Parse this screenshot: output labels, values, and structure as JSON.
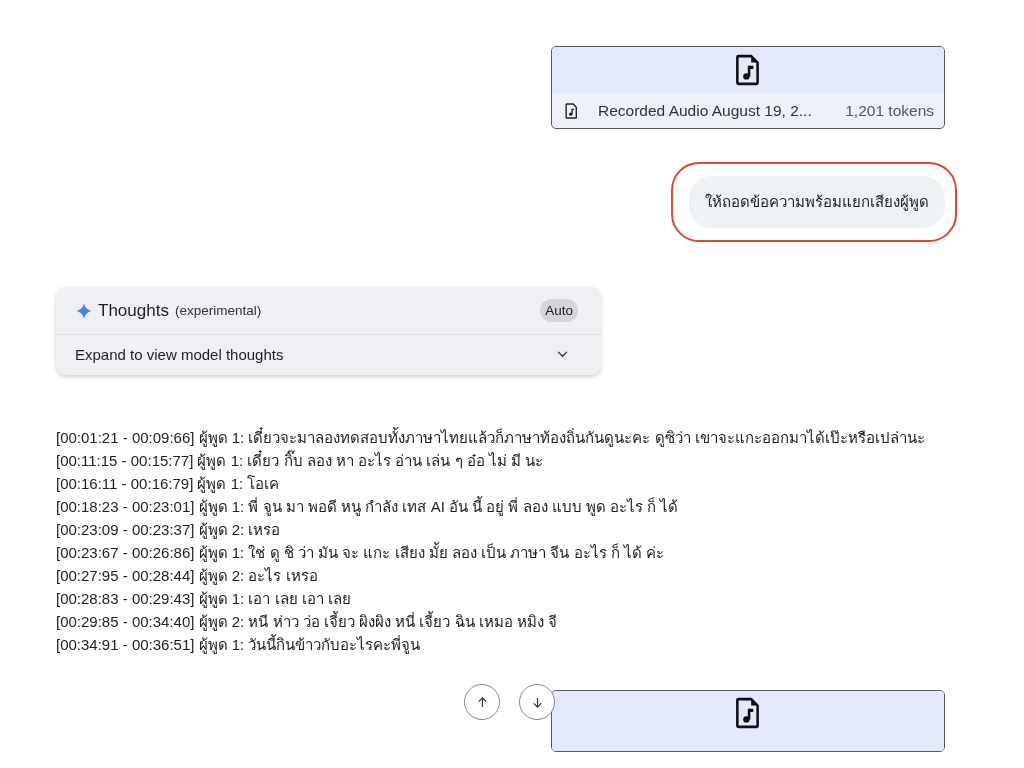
{
  "attachment": {
    "kind": "audio",
    "name": "Recorded Audio August 19, 2...",
    "tokens": "1,201 tokens"
  },
  "prompt": {
    "text": "ให้ถอดข้อความพร้อมแยกเสียงผู้พูด",
    "highlighted": true
  },
  "thoughts": {
    "title": "Thoughts",
    "subtitle": "(experimental)",
    "mode": "Auto",
    "expand_label": "Expand to view model thoughts",
    "expanded": false
  },
  "transcript": [
    "[00:01:21 - 00:09:66] ผู้พูด 1: เดี๋ยวจะมาลองทดสอบทั้งภาษาไทยแล้วก็ภาษาท้องถิ่นกันดูนะคะ ดูซิว่า เขาจะแกะออกมาได้เป๊ะหรือเปล่านะ",
    "[00:11:15 - 00:15:77] ผู้พูด 1: เดี๋ยว กิ๊บ ลอง หา อะไร อ่าน เล่น ๆ อ๋อ ไม่ มี นะ",
    "[00:16:11 - 00:16:79] ผู้พูด 1: โอเค",
    "[00:18:23 - 00:23:01] ผู้พูด 1: พี่ จูน มา พอดี หนู กำลัง เทส AI อัน นี้ อยู่ พี่ ลอง แบบ พูด อะไร ก็ ได้",
    "[00:23:09 - 00:23:37] ผู้พูด 2: เหรอ",
    "[00:23:67 - 00:26:86] ผู้พูด 1: ใช่ ดู ชิ ว่า มัน จะ แกะ เสียง มั้ย ลอง เป็น ภาษา จีน อะไร ก็ ได้ ค่ะ",
    "[00:27:95 - 00:28:44] ผู้พูด 2: อะไร เหรอ",
    "[00:28:83 - 00:29:43] ผู้พูด 1: เอา เลย เอา เลย",
    "[00:29:85 - 00:34:40] ผู้พูด 2: หนี ห่าว ว่อ เจี้ยว ผิงผิง หนี่ เจี้ยว ฉิน เหมอ หมิง จี",
    "[00:34:91 - 00:36:51] ผู้พูด 1: วันนี้กินข้าวกับอะไรคะพี่จูน"
  ],
  "next_attachment": {
    "kind": "audio"
  }
}
